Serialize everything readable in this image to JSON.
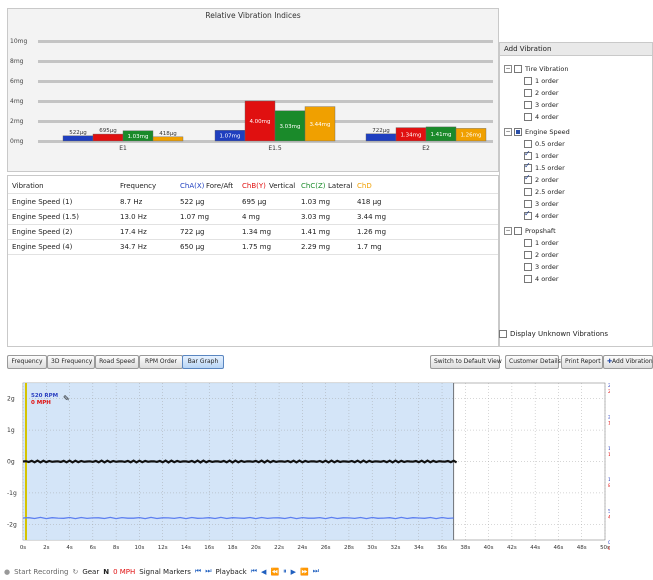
{
  "chart": {
    "title": "Relative Vibration Indices",
    "y_labels": [
      "10mg",
      "8mg",
      "6mg",
      "4mg",
      "2mg",
      "0mg"
    ]
  },
  "chart_data": {
    "type": "bar",
    "title": "Relative Vibration Indices",
    "categories": [
      "E1",
      "E1.5",
      "E2"
    ],
    "ylim": [
      0,
      10
    ],
    "y_unit": "mg",
    "series": [
      {
        "name": "ChA(X) Fore/Aft",
        "color": "#1f3fbf",
        "values": [
          0.522,
          1.07,
          0.722
        ],
        "labels": [
          "522µg",
          "1.07mg",
          "722µg"
        ]
      },
      {
        "name": "ChB(Y) Vertical",
        "color": "#e01010",
        "values": [
          0.695,
          4.0,
          1.34
        ],
        "labels": [
          "695µg",
          "4.00mg",
          "1.34mg"
        ]
      },
      {
        "name": "ChC(Z) Lateral",
        "color": "#1a8a2a",
        "values": [
          1.03,
          3.03,
          1.41
        ],
        "labels": [
          "1.03mg",
          "3.03mg",
          "1.41mg"
        ]
      },
      {
        "name": "ChD",
        "color": "#f0a000",
        "values": [
          0.418,
          3.44,
          1.26
        ],
        "labels": [
          "418µg",
          "3.44mg",
          "1.26mg"
        ]
      }
    ]
  },
  "table": {
    "headers": {
      "vibration": "Vibration",
      "frequency": "Frequency",
      "cha": "ChA(X)",
      "cha_dir": "Fore/Aft",
      "chb": "ChB(Y)",
      "chb_dir": "Vertical",
      "chc": "ChC(Z)",
      "chc_dir": "Lateral",
      "chd": "ChD"
    },
    "rows": [
      {
        "name": "Engine Speed (1)",
        "freq": "8.7 Hz",
        "a": "522 µg",
        "b": "695 µg",
        "c": "1.03 mg",
        "d": "418 µg"
      },
      {
        "name": "Engine Speed (1.5)",
        "freq": "13.0 Hz",
        "a": "1.07 mg",
        "b": "4 mg",
        "c": "3.03 mg",
        "d": "3.44 mg"
      },
      {
        "name": "Engine Speed (2)",
        "freq": "17.4 Hz",
        "a": "722 µg",
        "b": "1.34 mg",
        "c": "1.41 mg",
        "d": "1.26 mg"
      },
      {
        "name": "Engine Speed (4)",
        "freq": "34.7 Hz",
        "a": "650 µg",
        "b": "1.75 mg",
        "c": "2.29 mg",
        "d": "1.7 mg"
      }
    ]
  },
  "add_vibration": {
    "title": "Add Vibration",
    "groups": [
      {
        "label": "Tire Vibration",
        "state": "unchecked",
        "items": [
          {
            "label": "1 order",
            "checked": false
          },
          {
            "label": "2 order",
            "checked": false
          },
          {
            "label": "3 order",
            "checked": false
          },
          {
            "label": "4 order",
            "checked": false
          }
        ]
      },
      {
        "label": "Engine Speed",
        "state": "partial",
        "items": [
          {
            "label": "0.5 order",
            "checked": false
          },
          {
            "label": "1 order",
            "checked": true
          },
          {
            "label": "1.5 order",
            "checked": true
          },
          {
            "label": "2 order",
            "checked": true
          },
          {
            "label": "2.5 order",
            "checked": false
          },
          {
            "label": "3 order",
            "checked": false
          },
          {
            "label": "4 order",
            "checked": true
          }
        ]
      },
      {
        "label": "Propshaft",
        "state": "unchecked",
        "items": [
          {
            "label": "1 order",
            "checked": false
          },
          {
            "label": "2 order",
            "checked": false
          },
          {
            "label": "3 order",
            "checked": false
          },
          {
            "label": "4 order",
            "checked": false
          }
        ]
      }
    ],
    "display_unknown": "Display Unknown Vibrations"
  },
  "buttons": {
    "frequency": "Frequency",
    "frequency_3d": "3D Frequency",
    "road_speed": "Road Speed",
    "rpm_order": "RPM Order",
    "bar_graph": "Bar Graph",
    "switch_default": "Switch to Default View",
    "customer_details": "Customer Details",
    "print_report": "Print Report",
    "add_vibration": "Add Vibration"
  },
  "graph": {
    "y_left": [
      "2g",
      "1g",
      "0g",
      "-1g",
      "-2g"
    ],
    "x_labels": [
      "0s",
      "2s",
      "4s",
      "6s",
      "8s",
      "10s",
      "12s",
      "14s",
      "16s",
      "18s",
      "20s",
      "22s",
      "24s",
      "26s",
      "28s",
      "30s",
      "32s",
      "34s",
      "36s",
      "38s",
      "40s",
      "42s",
      "44s",
      "46s",
      "48s",
      "50s"
    ],
    "rpm_labels": [
      "2500RPM",
      "2000RPM",
      "1500RPM",
      "1000RPM",
      "500RPM",
      "0RPM"
    ],
    "mph_labels": [
      "20MPH",
      "16MPH",
      "12MPH",
      "8MPH",
      "4MPH",
      "0MPH"
    ],
    "readout_rpm": "520 RPM",
    "readout_mph": "0 MPH",
    "selection_end_s": 37,
    "x_max_s": 50
  },
  "status": {
    "start_recording": "Start Recording",
    "gear_label": "Gear",
    "gear_value": "N",
    "speed_value": "0 MPH",
    "signal_markers": "Signal Markers",
    "playback": "Playback"
  }
}
